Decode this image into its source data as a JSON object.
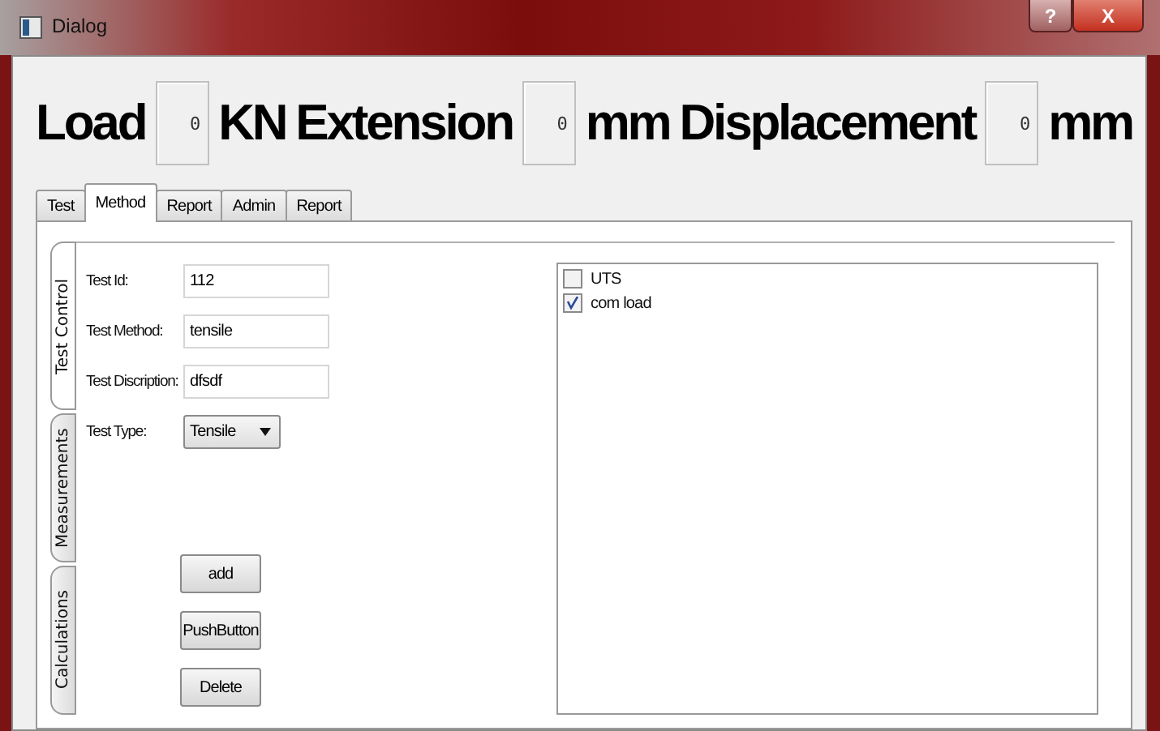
{
  "window": {
    "title": "Dialog",
    "buttons": [
      {
        "kind": "help",
        "label": "?"
      },
      {
        "kind": "close",
        "label": "X"
      }
    ]
  },
  "readouts": [
    {
      "label": "Load",
      "value": "0",
      "unit": "KN"
    },
    {
      "label": "Extension",
      "value": "0",
      "unit": "mm"
    },
    {
      "label": "Displacement",
      "value": "0",
      "unit": "mm"
    }
  ],
  "tabs": [
    {
      "label": "Test",
      "selected": false
    },
    {
      "label": "Method",
      "selected": true
    },
    {
      "label": "Report",
      "selected": false
    },
    {
      "label": "Admin",
      "selected": false
    },
    {
      "label": "Report",
      "selected": false
    }
  ],
  "side_tabs": [
    {
      "label": "Test Control",
      "selected": true
    },
    {
      "label": "Measurements",
      "selected": false
    },
    {
      "label": "Calculations",
      "selected": false
    }
  ],
  "form": [
    {
      "kind": "text",
      "label": "Test Id:",
      "value": "112"
    },
    {
      "kind": "text",
      "label": "Test Method:",
      "value": "tensile"
    },
    {
      "kind": "text",
      "label": "Test Discription:",
      "value": "dfsdf"
    },
    {
      "kind": "combo",
      "label": "Test Type:",
      "value": "Tensile"
    }
  ],
  "buttons": [
    "add",
    "PushButton",
    "Delete"
  ],
  "checklist": [
    {
      "label": "UTS",
      "checked": false
    },
    {
      "label": "com load",
      "checked": true
    }
  ]
}
